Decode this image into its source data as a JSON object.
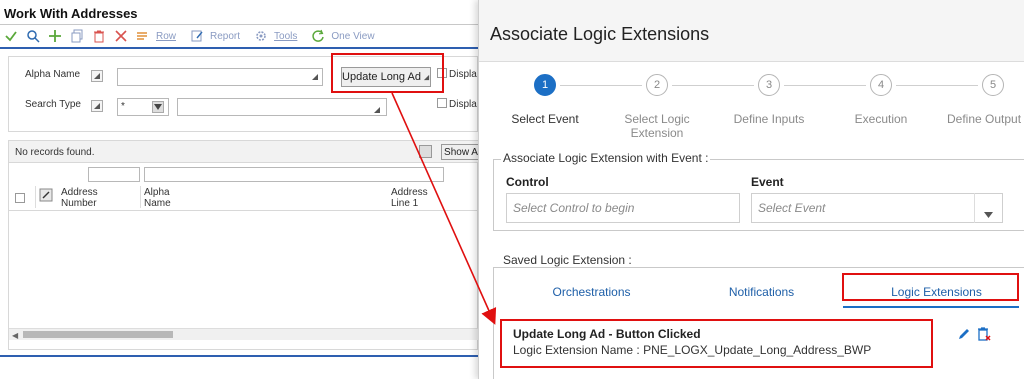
{
  "app": {
    "title": "Work With Addresses",
    "toolbar": {
      "row_label": "Row",
      "report_label": "Report",
      "tools_label": "Tools",
      "oneview_label": "One View"
    },
    "form": {
      "alpha_name_label": "Alpha Name",
      "alpha_name_value": "",
      "update_button_label": "Update Long Ad",
      "display_label_1": "Displa",
      "search_type_label": "Search Type",
      "search_type_value": "*",
      "search_type_desc_value": "",
      "display_label_2": "Displa"
    },
    "grid": {
      "status": "No records found.",
      "show_all_label": "Show A",
      "columns": [
        {
          "line1": "Address",
          "line2": "Number"
        },
        {
          "line1": "Alpha",
          "line2": "Name"
        },
        {
          "line1": "Address",
          "line2": "Line 1"
        }
      ]
    }
  },
  "panel": {
    "title": "Associate Logic Extensions",
    "steps": [
      {
        "number": "1",
        "label_line1": "Select Event",
        "label_line2": "",
        "active": true
      },
      {
        "number": "2",
        "label_line1": "Select Logic",
        "label_line2": "Extension",
        "active": false
      },
      {
        "number": "3",
        "label_line1": "Define Inputs",
        "label_line2": "",
        "active": false
      },
      {
        "number": "4",
        "label_line1": "Execution",
        "label_line2": "",
        "active": false
      },
      {
        "number": "5",
        "label_line1": "Define Output",
        "label_line2": "",
        "active": false
      }
    ],
    "associate_section": {
      "legend": "Associate Logic Extension with Event :",
      "control_label": "Control",
      "control_placeholder": "Select Control to begin",
      "event_label": "Event",
      "event_placeholder": "Select Event"
    },
    "saved_section": {
      "legend": "Saved Logic Extension :",
      "tabs": [
        "Orchestrations",
        "Notifications",
        "Logic Extensions"
      ],
      "active_tab": "Logic Extensions",
      "item": {
        "title": "Update Long Ad - Button Clicked",
        "subtitle": "Logic Extension Name : PNE_LOGX_Update_Long_Address_BWP"
      }
    }
  },
  "colors": {
    "accent_blue": "#1c6fc5",
    "annotation_red": "#e01010",
    "toolbar_green": "#5aa83a",
    "toolbar_red": "#d9534f"
  }
}
